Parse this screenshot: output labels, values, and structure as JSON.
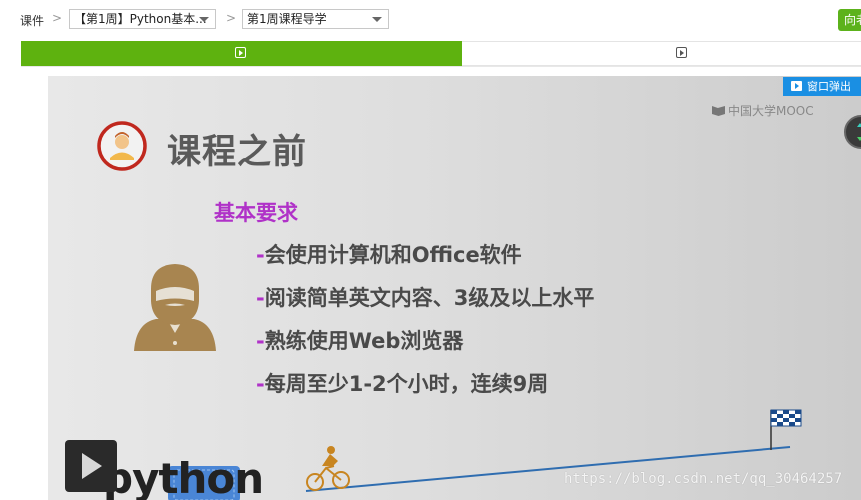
{
  "breadcrumb": {
    "root_label": "课件",
    "week_select": "【第1周】Python基本...",
    "lesson_select": "第1周课程导学",
    "right_button": "向老"
  },
  "tabs": [
    {
      "icon": "play-video-icon",
      "active": true
    },
    {
      "icon": "play-video-icon",
      "active": false
    }
  ],
  "video": {
    "popout_label": "窗口弹出",
    "logo_text": "中国大学MOOC",
    "slide": {
      "title": "课程之前",
      "subtitle": "基本要求",
      "requirements": [
        {
          "dash": "-",
          "text": "会使用计算机和Office软件"
        },
        {
          "dash": "-",
          "text": "阅读简单英文内容、3级及以上水平"
        },
        {
          "dash": "-",
          "text": "熟练使用Web浏览器"
        },
        {
          "dash": "-",
          "text": "每周至少1-2个小时，连续9周"
        }
      ],
      "python_text": "python"
    },
    "watermark": "https://blog.csdn.net/qq_30464257"
  },
  "colors": {
    "tab_active": "#5eb20f",
    "accent_purple": "#b032c8",
    "popout_blue": "#1a8fe3",
    "avatar_ring": "#c0281e",
    "figure_brown": "#a88550",
    "cyclist_orange": "#c88520",
    "road_blue": "#2f6db0"
  }
}
